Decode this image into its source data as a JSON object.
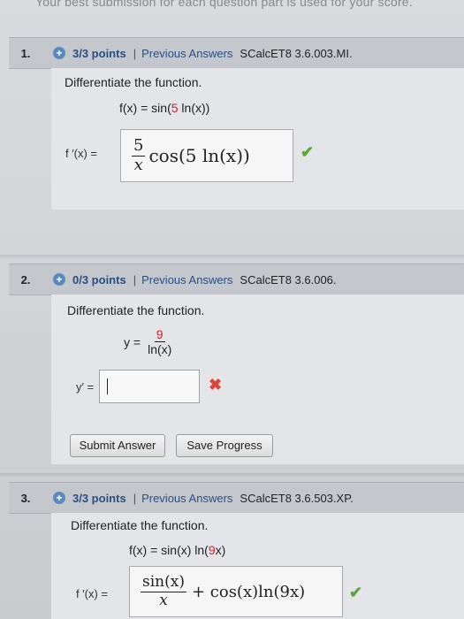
{
  "banner": "Your best submission for each question part is used for your score.",
  "questions": [
    {
      "number": "1.",
      "points": "3/3 points",
      "separator": "|",
      "prev_link": "Previous Answers",
      "source": "SCalcET8 3.6.003.MI.",
      "instruction": "Differentiate the function.",
      "function_lhs": "f(x) = sin(",
      "function_red": "5",
      "function_rhs": " ln(x))",
      "answer_label": "f ′(x) =",
      "answer_num": "5",
      "answer_den": "x",
      "answer_tail": "cos(5 ln(x))",
      "status": "correct"
    },
    {
      "number": "2.",
      "points": "0/3 points",
      "separator": "|",
      "prev_link": "Previous Answers",
      "source": "SCalcET8 3.6.006.",
      "instruction": "Differentiate the function.",
      "function_lhs": "y =",
      "function_num": "9",
      "function_den": "ln(x)",
      "answer_label": "y′ =",
      "answer_value": "",
      "status": "incorrect",
      "submit_label": "Submit Answer",
      "save_label": "Save Progress"
    },
    {
      "number": "3.",
      "points": "3/3 points",
      "separator": "|",
      "prev_link": "Previous Answers",
      "source": "SCalcET8 3.6.503.XP.",
      "instruction": "Differentiate the function.",
      "function_lhs": "f(x) = sin(x) ln(",
      "function_red": "9",
      "function_rhs": "x)",
      "answer_label": "f ′(x) =",
      "answer_num": "sin(x)",
      "answer_den": "x",
      "answer_tail": "+ cos(x)ln(9x)",
      "status": "correct"
    }
  ],
  "colors": {
    "link": "#2a4e86",
    "correct": "#5aa838",
    "incorrect": "#d9463a",
    "highlight": "#cc2233"
  },
  "icons": {
    "status": "plus-circle-icon",
    "correct": "checkmark-icon",
    "incorrect": "x-mark-icon"
  }
}
